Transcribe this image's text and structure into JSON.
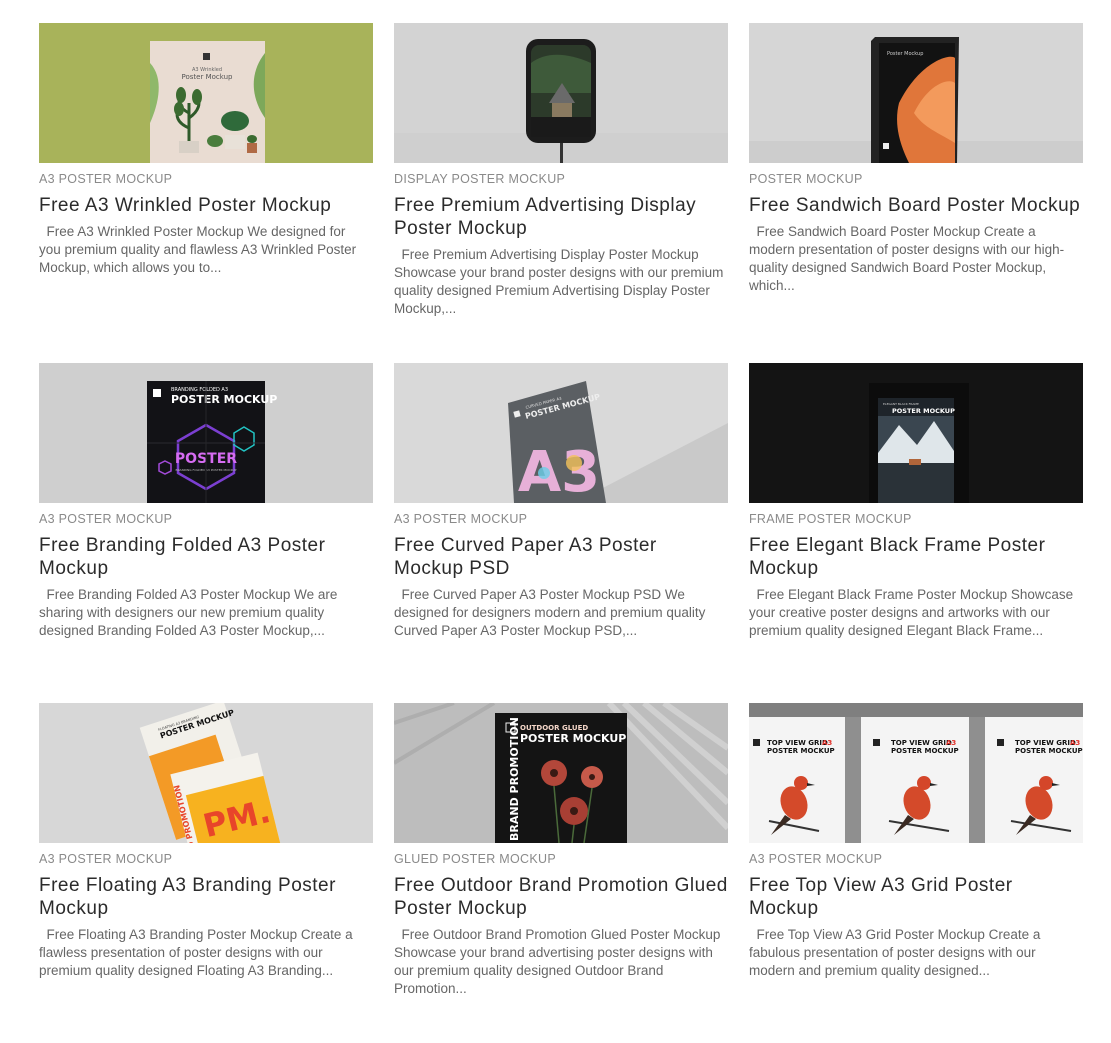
{
  "cards": [
    {
      "category": "A3 POSTER MOCKUP",
      "title": "Free A3 Wrinkled Poster Mockup",
      "excerpt": "  Free A3 Wrinkled Poster Mockup We designed for you premium quality and flawless A3 Wrinkled Poster Mockup, which allows you to...",
      "thumb": {
        "poster_title": "Poster Mockup",
        "poster_sub": "A3 Wrinkled"
      }
    },
    {
      "category": "DISPLAY POSTER MOCKUP",
      "title": "Free Premium Advertising Display Poster Mockup",
      "excerpt": "  Free Premium Advertising Display Poster Mockup Showcase your brand poster designs with our premium quality designed Premium Advertising Display Poster Mockup,...",
      "thumb": {}
    },
    {
      "category": "POSTER MOCKUP",
      "title": "Free Sandwich Board Poster Mockup",
      "excerpt": "  Free Sandwich Board Poster Mockup Create a modern presentation of poster designs with our high-quality designed Sandwich Board Poster Mockup, which...",
      "thumb": {
        "poster_title": "Poster Mockup"
      }
    },
    {
      "category": "A3 POSTER MOCKUP",
      "title": "Free Branding Folded A3 Poster Mockup",
      "excerpt": "  Free Branding Folded A3 Poster Mockup We are sharing with designers our new premium quality designed Branding Folded A3 Poster Mockup,...",
      "thumb": {
        "poster_top": "BRANDING FOLDED A3",
        "poster_title": "POSTER MOCKUP",
        "poster_center": "POSTER",
        "poster_center_sub": "BRANDING FOLDED A3 POSTER MOCKUP"
      }
    },
    {
      "category": "A3 POSTER MOCKUP",
      "title": "Free Curved Paper A3 Poster Mockup PSD",
      "excerpt": "  Free Curved Paper A3 Poster Mockup PSD We designed for designers modern and premium quality Curved Paper A3 Poster Mockup PSD,...",
      "thumb": {
        "poster_title": "POSTER MOCKUP",
        "poster_top": "CURVED PAPER A3",
        "poster_big": "A3"
      }
    },
    {
      "category": "FRAME POSTER MOCKUP",
      "title": "Free Elegant Black Frame Poster Mockup",
      "excerpt": "  Free Elegant Black Frame Poster Mockup Showcase your creative poster designs and artworks with our premium quality designed Elegant Black Frame...",
      "thumb": {
        "poster_title": "POSTER MOCKUP",
        "poster_top": "ELEGANT BLACK FRAME"
      }
    },
    {
      "category": "A3 POSTER MOCKUP",
      "title": "Free Floating A3 Branding Poster Mockup",
      "excerpt": "  Free Floating A3 Branding Poster Mockup Create a flawless presentation of poster designs with our premium quality designed Floating A3 Branding...",
      "thumb": {
        "poster_title": "POSTER MOCKUP",
        "poster_top": "FLOATING A3 BRANDING",
        "poster_big": "PM.",
        "poster_side": "BRAND PROMOTION"
      }
    },
    {
      "category": "GLUED POSTER MOCKUP",
      "title": "Free Outdoor Brand Promotion Glued Poster Mockup",
      "excerpt": "  Free Outdoor Brand Promotion Glued Poster Mockup Showcase your brand advertising poster designs with our premium quality designed Outdoor Brand Promotion...",
      "thumb": {
        "poster_top": "OUTDOOR GLUED",
        "poster_title": "POSTER MOCKUP",
        "poster_side": "BRAND PROMOTION"
      }
    },
    {
      "category": "A3 POSTER MOCKUP",
      "title": "Free Top View A3 Grid Poster Mockup",
      "excerpt": "  Free Top View A3 Grid Poster Mockup Create a fabulous presentation of poster designs with our modern and premium quality designed...",
      "thumb": {
        "poster_top": "TOP VIEW GRID",
        "poster_top_accent": "A3",
        "poster_title": "POSTER MOCKUP"
      }
    }
  ],
  "colors": {
    "card_title": "#2b2b2b",
    "category": "#8a8a8a",
    "excerpt": "#666666",
    "accent_red": "#e0322b"
  }
}
